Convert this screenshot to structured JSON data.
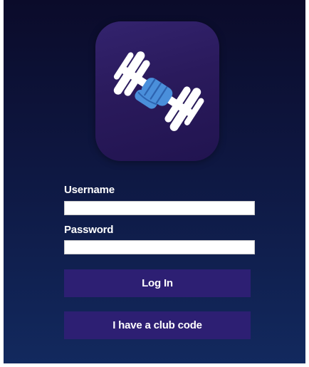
{
  "login": {
    "username_label": "Username",
    "username_value": "",
    "password_label": "Password",
    "password_value": "",
    "login_button": "Log In",
    "club_code_button": "I have a club code"
  },
  "colors": {
    "background_top": "#0b0b2a",
    "background_bottom": "#12295e",
    "logo_tile": "#2a1a5c",
    "button": "#2d1f73",
    "hand": "#4a8fdb",
    "dumbbell": "#ffffff"
  },
  "icons": {
    "logo": "dumbbell-in-hand-icon"
  }
}
